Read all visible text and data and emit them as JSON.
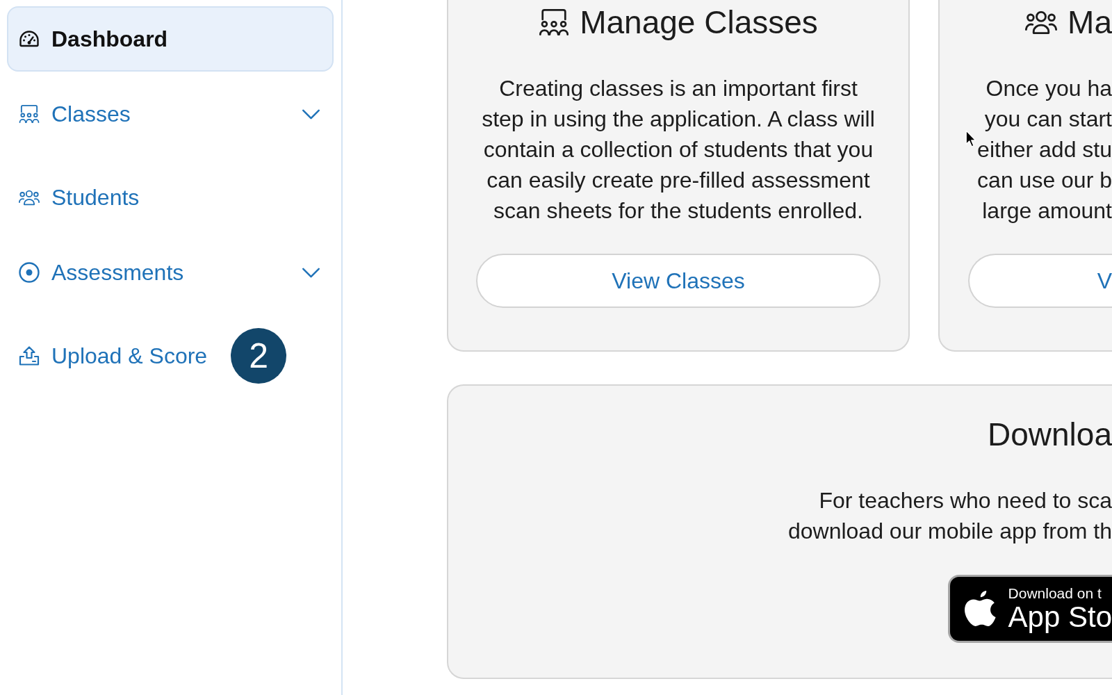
{
  "sidebar": {
    "items": [
      {
        "label": "Dashboard",
        "kind": "link",
        "selected": true
      },
      {
        "label": "Classes",
        "kind": "group",
        "selected": false,
        "expanded": false
      },
      {
        "label": "Students",
        "kind": "link",
        "selected": false
      },
      {
        "label": "Assessments",
        "kind": "group",
        "selected": false,
        "expanded": false
      },
      {
        "label": "Upload & Score",
        "kind": "link",
        "selected": false,
        "badge": "2"
      }
    ]
  },
  "cards": [
    {
      "title": "Manage Classes",
      "body": "Creating classes is an important first step in using the application. A class will contain a collection of students that you can easily create pre-filled assessment scan sheets for the students enrolled.",
      "button": "View Classes"
    },
    {
      "title": "Ma",
      "body_lines": [
        "Once you ha",
        "you can start",
        "either add stu",
        "can use our b",
        "large amount"
      ],
      "button": "V"
    }
  ],
  "download": {
    "title": "Downloa",
    "body_lines": [
      "For teachers who need to sca",
      "download our mobile app from th"
    ],
    "store_badge": {
      "caption": "Download on t",
      "name": "App Sto"
    }
  }
}
